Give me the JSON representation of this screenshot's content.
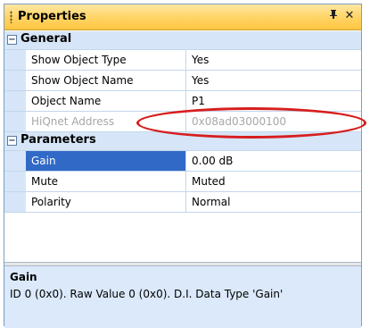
{
  "panel": {
    "title": "Properties",
    "pin_glyph": "❙",
    "close_glyph": "✕"
  },
  "categories": [
    {
      "label": "General",
      "toggle": "−",
      "rows": [
        {
          "name": "Show Object Type",
          "value": "Yes"
        },
        {
          "name": "Show Object Name",
          "value": "Yes"
        },
        {
          "name": "Object Name",
          "value": "P1"
        },
        {
          "name": "HiQnet Address",
          "value": "0x08ad03000100",
          "disabled": true
        }
      ]
    },
    {
      "label": "Parameters",
      "toggle": "−",
      "rows": [
        {
          "name": "Gain",
          "value": "0.00 dB",
          "selected": true
        },
        {
          "name": "Mute",
          "value": "Muted"
        },
        {
          "name": "Polarity",
          "value": "Normal"
        }
      ]
    }
  ],
  "description": {
    "title": "Gain",
    "text": "ID 0 (0x0). Raw Value 0 (0x0). D.I. Data Type 'Gain'"
  },
  "colors": {
    "selection": "#3169c6",
    "annotation": "#d71e1e",
    "category_bg": "#d6e6f8"
  }
}
